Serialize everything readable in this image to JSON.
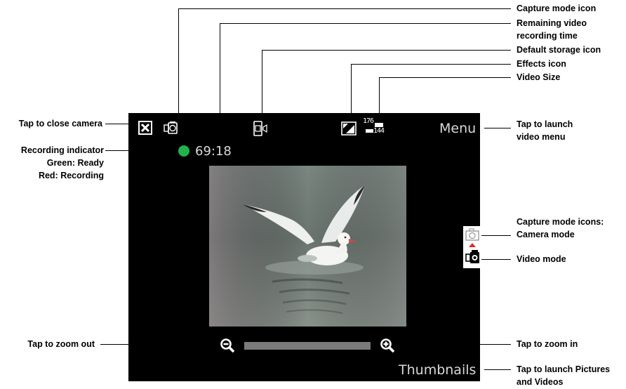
{
  "annotations": {
    "capture_mode_icon": "Capture mode icon",
    "remaining_time_l1": "Remaining video",
    "remaining_time_l2": "recording time",
    "default_storage": "Default storage icon",
    "effects": "Effects icon",
    "video_size": "Video Size",
    "close_camera": "Tap to close camera",
    "rec_indicator_l1": "Recording indicator",
    "rec_indicator_l2": "Green: Ready",
    "rec_indicator_l3": "Red: Recording",
    "launch_menu_l1": "Tap to launch",
    "launch_menu_l2": "video menu",
    "capture_modes_l1": "Capture mode icons:",
    "capture_modes_l2": "Camera mode",
    "video_mode": "Video mode",
    "zoom_out": "Tap to zoom out",
    "zoom_in": "Tap to zoom in",
    "launch_pictures_l1": "Tap to launch Pictures",
    "launch_pictures_l2": "and Videos"
  },
  "screen": {
    "menu_label": "Menu",
    "thumbnails_label": "Thumbnails",
    "remaining_time": "69:18",
    "video_size_top": "176",
    "video_size_bottom": "144",
    "recording_status": "ready",
    "indicator_color": "#22b14c"
  },
  "icons": {
    "close": "close-icon",
    "capture_mode": "video-camera-icon",
    "storage": "storage-card-icon",
    "effects": "effects-icon",
    "video_size": "video-size-icon",
    "camera_mode": "camera-icon",
    "video_mode": "video-camera-icon",
    "zoom_out": "zoom-out-icon",
    "zoom_in": "zoom-in-icon"
  }
}
